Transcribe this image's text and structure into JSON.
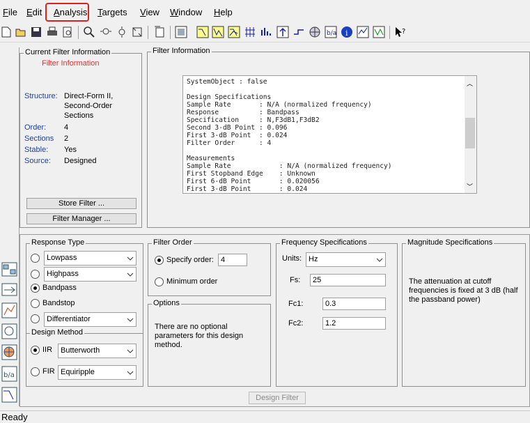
{
  "menu": {
    "items": [
      {
        "label": "File",
        "key": "F"
      },
      {
        "label": "Edit",
        "key": "E"
      },
      {
        "label": "Analysis",
        "key": "A"
      },
      {
        "label": "Targets",
        "key": "T"
      },
      {
        "label": "View",
        "key": "V"
      },
      {
        "label": "Window",
        "key": "W"
      },
      {
        "label": "Help",
        "key": "H"
      }
    ],
    "highlight_color": "#e02020"
  },
  "toolbar": {
    "icons": [
      "new-icon",
      "open-icon",
      "save-icon",
      "print-icon",
      "print-preview-icon",
      "zoom-in-icon",
      "zoom-x-icon",
      "zoom-y-icon",
      "full-view-icon",
      "new-plot-icon",
      "filter-spec-icon",
      "magnitude-response-icon",
      "phase-response-icon",
      "magnitude-phase-icon",
      "group-delay-icon",
      "impulse-response-icon",
      "step-response-icon",
      "pole-zero-icon",
      "filter-coefficients-icon",
      "filter-info-icon",
      "legend-icon",
      "grid-icon",
      "whats-this-icon"
    ]
  },
  "current_filter": {
    "title": "Current Filter Information",
    "heading": "Filter Information",
    "structure_label": "Structure:",
    "structure_value_1": "Direct-Form II,",
    "structure_value_2": "Second-Order",
    "structure_value_3": "Sections",
    "order_label": "Order:",
    "order_value": "4",
    "sections_label": "Sections",
    "sections_value": "2",
    "stable_label": "Stable:",
    "stable_value": "Yes",
    "source_label": "Source:",
    "source_value": "Designed",
    "store_button": "Store Filter ...",
    "manager_button": "Filter Manager ..."
  },
  "filter_info": {
    "title": "Filter Information",
    "text": "SystemObject : false\n\nDesign Specifications\nSample Rate       : N/A (normalized frequency)\nResponse          : Bandpass\nSpecification     : N,F3dB1,F3dB2\nSecond 3-dB Point : 0.096\nFirst 3-dB Point  : 0.024\nFilter Order      : 4\n\nMeasurements\nSample Rate            : N/A (normalized frequency)\nFirst Stopband Edge    : Unknown\nFirst 6-dB Point       : 0.020056\nFirst 3-dB Point       : 0.024\nFirst Passband Edge    : Unknown"
  },
  "response_type": {
    "title": "Response Type",
    "lowpass": "Lowpass",
    "highpass": "Highpass",
    "bandpass": "Bandpass",
    "bandstop": "Bandstop",
    "differentiator": "Differentiator"
  },
  "design_method": {
    "title": "Design Method",
    "iir_label": "IIR",
    "iir_value": "Butterworth",
    "fir_label": "FIR",
    "fir_value": "Equiripple"
  },
  "filter_order": {
    "title": "Filter Order",
    "specify_label": "Specify order:",
    "specify_value": "4",
    "minimum_label": "Minimum order"
  },
  "options": {
    "title": "Options",
    "text": "There are no optional parameters for this design method."
  },
  "freq_specs": {
    "title": "Frequency Specifications",
    "units_label": "Units:",
    "units_value": "Hz",
    "fs_label": "Fs:",
    "fs_value": "25",
    "fc1_label": "Fc1:",
    "fc1_value": "0.3",
    "fc2_label": "Fc2:",
    "fc2_value": "1.2"
  },
  "mag_specs": {
    "title": "Magnitude Specifications",
    "text": "The attenuation at cutoff frequencies is fixed at 3 dB (half the passband power)"
  },
  "design_button": "Design Filter",
  "status": "Ready"
}
